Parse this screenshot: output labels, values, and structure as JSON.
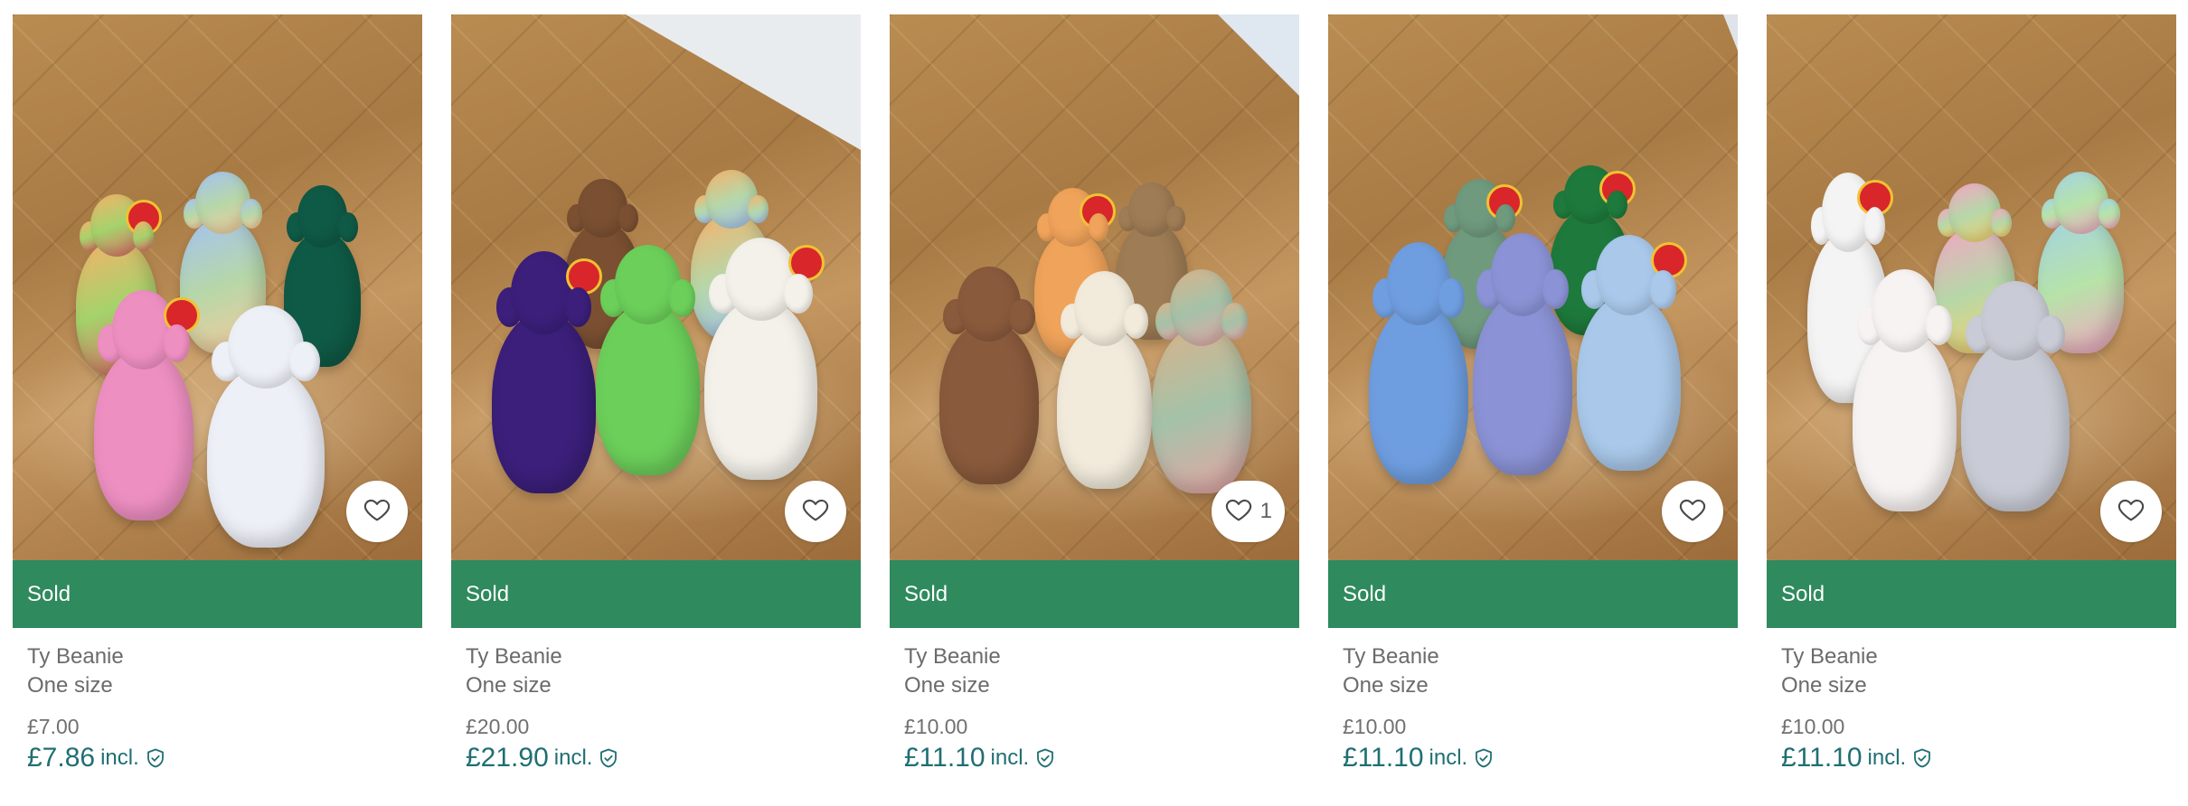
{
  "icons": {
    "favorite": "heart-outline-icon",
    "buyer_protection": "shield-check-icon"
  },
  "colors": {
    "sold_banner": "#2f8a5e",
    "total_price": "#1f6f73",
    "secondary_text": "#6b6b6b"
  },
  "items": [
    {
      "photo_alt": "Ty Beanie bears on wooden floor",
      "favorite_count": "",
      "status": "Sold",
      "brand": "Ty Beanie",
      "size": "One size",
      "price": "£7.00",
      "total_price": "£7.86",
      "total_suffix": "incl."
    },
    {
      "photo_alt": "Ty Beanie bears on wooden floor",
      "favorite_count": "",
      "status": "Sold",
      "brand": "Ty Beanie",
      "size": "One size",
      "price": "£20.00",
      "total_price": "£21.90",
      "total_suffix": "incl."
    },
    {
      "photo_alt": "Ty Beanie bears on wooden floor",
      "favorite_count": "1",
      "status": "Sold",
      "brand": "Ty Beanie",
      "size": "One size",
      "price": "£10.00",
      "total_price": "£11.10",
      "total_suffix": "incl."
    },
    {
      "photo_alt": "Ty Beanie bears on wooden floor",
      "favorite_count": "",
      "status": "Sold",
      "brand": "Ty Beanie",
      "size": "One size",
      "price": "£10.00",
      "total_price": "£11.10",
      "total_suffix": "incl."
    },
    {
      "photo_alt": "Ty Beanie bears on wooden floor",
      "favorite_count": "",
      "status": "Sold",
      "brand": "Ty Beanie",
      "size": "One size",
      "price": "£10.00",
      "total_price": "£11.10",
      "total_suffix": "incl."
    }
  ]
}
